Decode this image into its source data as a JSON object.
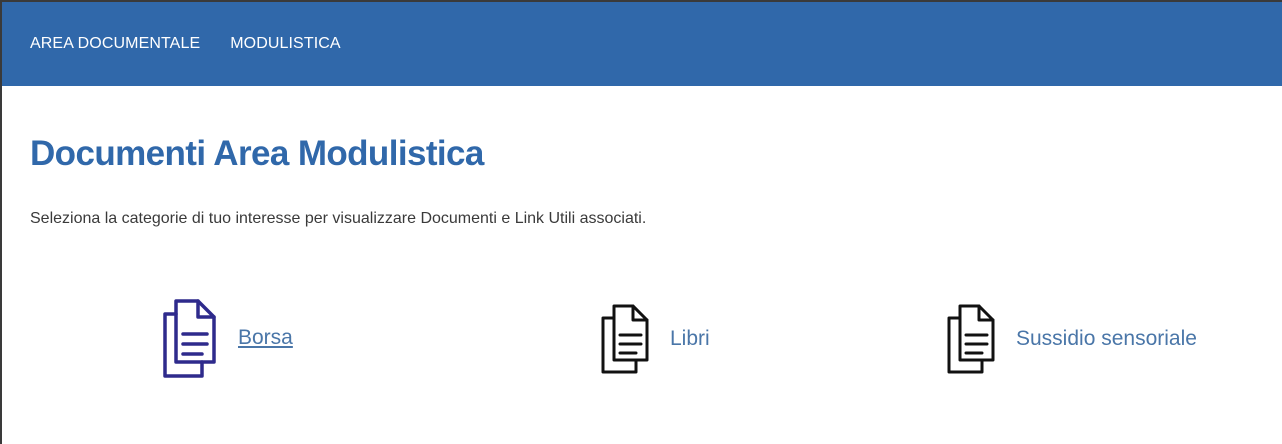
{
  "nav": {
    "items": [
      {
        "label": "AREA DOCUMENTALE"
      },
      {
        "label": "MODULISTICA"
      }
    ]
  },
  "page": {
    "title": "Documenti Area Modulistica",
    "intro": "Seleziona la categorie di tuo interesse per visualizzare Documenti e Link Utili associati."
  },
  "categories": [
    {
      "label": "Borsa",
      "icon": "documents-icon",
      "icon_color": "#2e2a8c",
      "underlined": true
    },
    {
      "label": "Libri",
      "icon": "documents-icon",
      "icon_color": "#111111",
      "underlined": false
    },
    {
      "label": "Sussidio sensoriale",
      "icon": "documents-icon",
      "icon_color": "#111111",
      "underlined": false
    }
  ],
  "colors": {
    "nav_background": "#3068aa",
    "title": "#3068aa",
    "link": "#4a76a8"
  }
}
